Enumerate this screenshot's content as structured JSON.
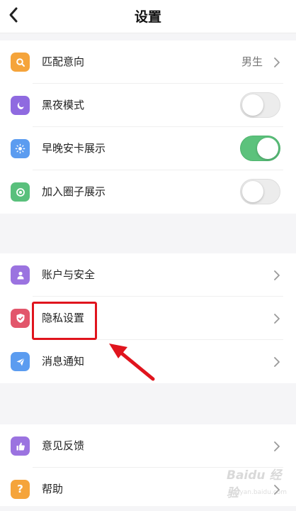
{
  "header": {
    "title": "设置"
  },
  "sections": [
    {
      "items": [
        {
          "label": "匹配意向",
          "icon": "search-icon",
          "icon_color": "#f5a43b",
          "value": "男生",
          "control": "chevron"
        },
        {
          "label": "黑夜模式",
          "icon": "moon-icon",
          "icon_color": "#8f6ae0",
          "control": "toggle",
          "toggle_on": false
        },
        {
          "label": "早晚安卡展示",
          "icon": "sun-icon",
          "icon_color": "#5b9cf0",
          "control": "toggle",
          "toggle_on": true
        },
        {
          "label": "加入圈子展示",
          "icon": "target-icon",
          "icon_color": "#59c07c",
          "control": "toggle",
          "toggle_on": false
        }
      ]
    },
    {
      "items": [
        {
          "label": "账户与安全",
          "icon": "user-icon",
          "icon_color": "#9b73e0",
          "control": "chevron"
        },
        {
          "label": "隐私设置",
          "icon": "shield-icon",
          "icon_color": "#e2566b",
          "control": "chevron"
        },
        {
          "label": "消息通知",
          "icon": "send-icon",
          "icon_color": "#5b9cf0",
          "control": "chevron"
        }
      ]
    },
    {
      "items": [
        {
          "label": "意见反馈",
          "icon": "thumbs-up-icon",
          "icon_color": "#9b73e0",
          "control": "chevron"
        },
        {
          "label": "帮助",
          "icon": "question-icon",
          "icon_color": "#f5a43b",
          "control": "chevron"
        }
      ]
    }
  ],
  "annotation": {
    "highlight_color": "#e0141d"
  },
  "watermark": {
    "brand": "Baidu 经验",
    "url": "jingyan.baidu.com"
  }
}
